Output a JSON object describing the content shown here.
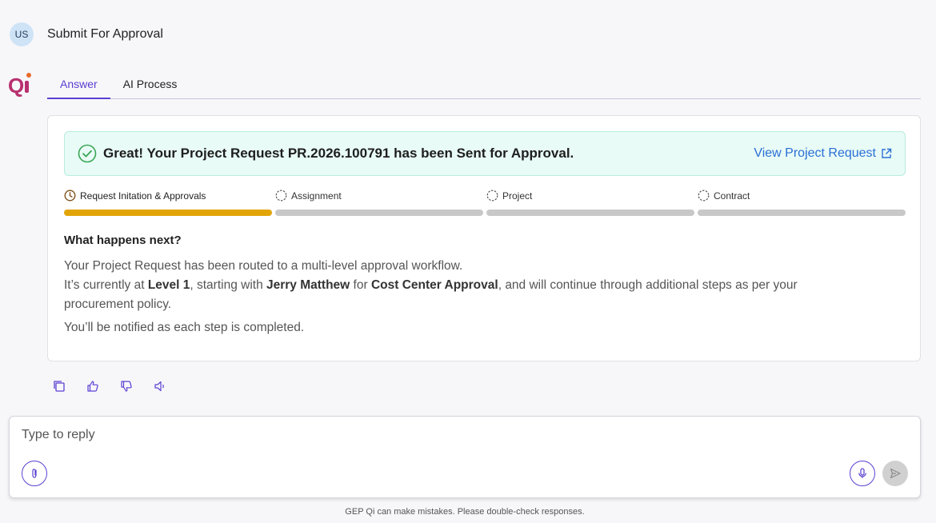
{
  "user": {
    "initials": "US",
    "message": "Submit For Approval"
  },
  "tabs": [
    {
      "label": "Answer",
      "active": true
    },
    {
      "label": "AI Process",
      "active": false
    }
  ],
  "banner": {
    "message": "Great! Your Project Request PR.2026.100791 has been Sent for Approval.",
    "link_label": "View Project Request"
  },
  "steps": [
    {
      "label": "Request Initation & Approvals",
      "status": "in-progress"
    },
    {
      "label": "Assignment",
      "status": "pending"
    },
    {
      "label": "Project",
      "status": "pending"
    },
    {
      "label": "Contract",
      "status": "pending"
    }
  ],
  "next": {
    "title": "What happens next?",
    "line1": "Your Project Request has been routed to a multi-level approval workflow.",
    "line2_a": "It’s currently at ",
    "line2_level": "Level 1",
    "line2_b": ", starting with ",
    "line2_person": "Jerry Matthew",
    "line2_c": " for ",
    "line2_stage": "Cost Center Approval",
    "line2_d": ", and will continue through additional steps as per your procurement policy.",
    "notify": "You’ll be notified as each step is completed."
  },
  "composer": {
    "placeholder": "Type to reply"
  },
  "disclaimer": "GEP Qi can make mistakes. Please double-check responses.",
  "colors": {
    "accent": "#5b3fd1",
    "progress": "#e2a508",
    "success": "#3aa655",
    "link": "#2b6fd6"
  }
}
